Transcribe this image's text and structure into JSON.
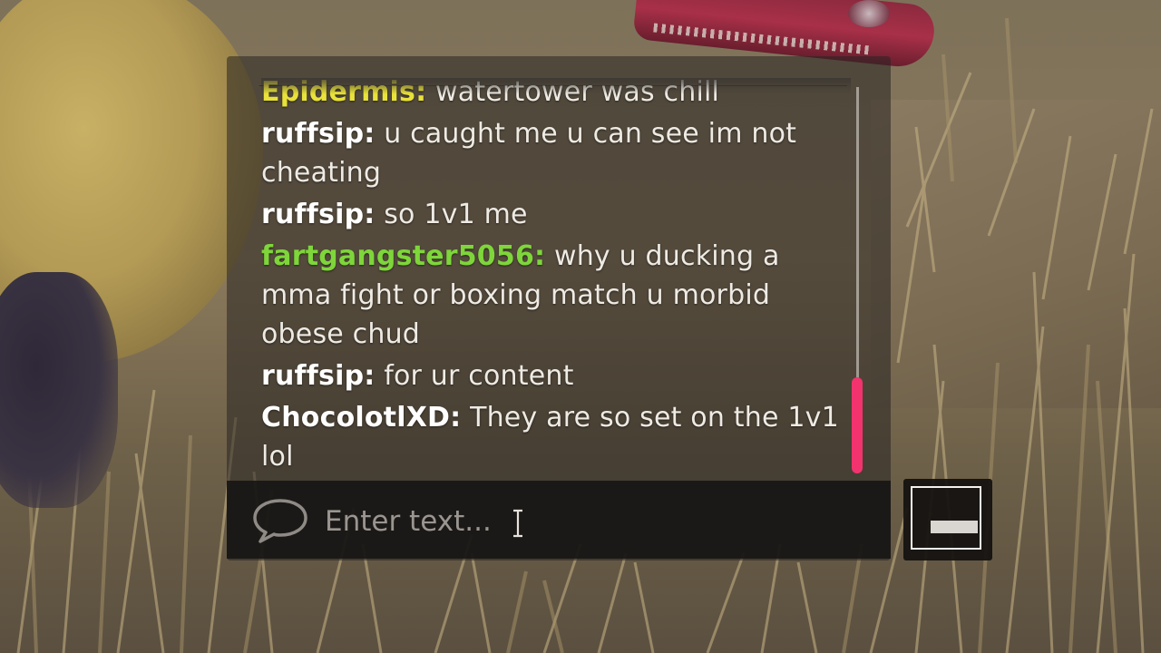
{
  "chat": {
    "messages": [
      {
        "user": "Epidermis:",
        "text": " watertower was chill",
        "color": "#e9e23a"
      },
      {
        "user": "ruffsip:",
        "text": " u caught me u can see im not cheating",
        "color": "#ffffff"
      },
      {
        "user": "ruffsip:",
        "text": " so 1v1 me",
        "color": "#ffffff"
      },
      {
        "user": "fartgangster5056:",
        "text": " why u ducking a mma fight or boxing match u morbid obese chud",
        "color": "#7ed63a"
      },
      {
        "user": "ruffsip:",
        "text": " for ur content",
        "color": "#ffffff"
      },
      {
        "user": "ChocolotlXD:",
        "text": " They are so set on the 1v1 lol",
        "color": "#ffffff"
      }
    ],
    "scrollbar_color": "#f2336e"
  },
  "input": {
    "placeholder": "Enter text...",
    "value": "",
    "icon": "speech-bubble-icon"
  },
  "side_button": {
    "icon": "keyboard-key-icon"
  }
}
